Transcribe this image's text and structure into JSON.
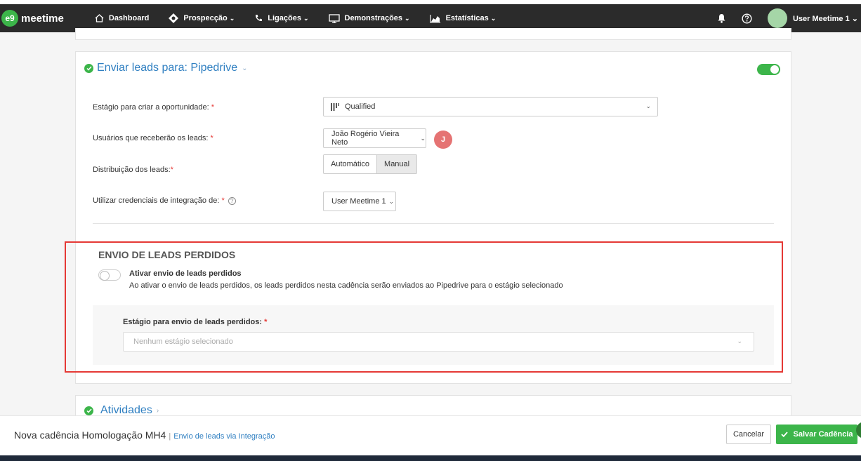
{
  "nav": {
    "logo_mark": "e9",
    "logo_text": "meetime",
    "items": [
      {
        "label": "Dashboard",
        "chevron": ""
      },
      {
        "label": "Prospecção",
        "chevron": "⌄"
      },
      {
        "label": "Ligações",
        "chevron": "⌄"
      },
      {
        "label": "Demonstrações",
        "chevron": "⌄"
      },
      {
        "label": "Estatísticas",
        "chevron": "⌄"
      }
    ],
    "user_name": "User Meetime 1",
    "user_chevron": "⌄"
  },
  "section": {
    "title": "Enviar leads para: Pipedrive",
    "toggle_on": true,
    "fields": {
      "stage_label": "Estágio para criar a oportunidade:",
      "stage_value": "Qualified",
      "users_label": "Usuários que receberão os leads:",
      "users_value": "João Rogério Vieira Neto",
      "user_initial": "J",
      "distribution_label": "Distribuição dos leads:",
      "distribution_options": [
        "Automático",
        "Manual"
      ],
      "distribution_selected": "Manual",
      "credentials_label": "Utilizar credenciais de integração de:",
      "credentials_value": "User Meetime 1",
      "required_mark": "*",
      "help_glyph": "?"
    }
  },
  "lost_leads": {
    "title": "ENVIO DE LEADS PERDIDOS",
    "toggle_on": false,
    "toggle_label": "Ativar envio de leads perdidos",
    "toggle_desc": "Ao ativar o envio de leads perdidos, os leads perdidos nesta cadência serão enviados ao Pipedrive para o estágio selecionado",
    "stage_label": "Estágio para envio de leads perdidos:",
    "stage_placeholder": "Nenhum estágio selecionado"
  },
  "activities": {
    "title": "Atividades"
  },
  "footer": {
    "title": "Nova cadência Homologação MH4",
    "separator": "|",
    "subtitle": "Envio de leads via Integração",
    "cancel_label": "Cancelar",
    "save_label": "Salvar Cadência"
  },
  "colors": {
    "accent_green": "#3cb54a",
    "link_blue": "#2f7fc1",
    "highlight_red": "#e53935",
    "navbar_bg": "#2b2b2b"
  }
}
